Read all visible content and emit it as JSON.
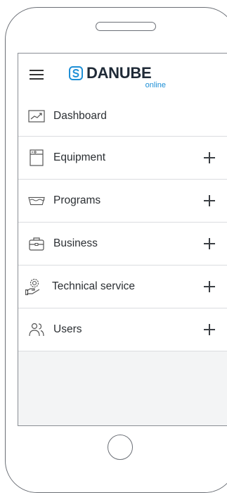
{
  "header": {
    "menu_icon": "hamburger-icon",
    "logo": {
      "icon": "danube-logo-icon",
      "name": "DANUBE",
      "sub": "online",
      "accent_color": "#1e8fd6"
    }
  },
  "menu": {
    "items": [
      {
        "label": "Dashboard",
        "icon": "chart-icon",
        "expandable": false
      },
      {
        "label": "Equipment",
        "icon": "washing-machine-icon",
        "expandable": true
      },
      {
        "label": "Programs",
        "icon": "basin-icon",
        "expandable": true
      },
      {
        "label": "Business",
        "icon": "briefcase-icon",
        "expandable": true
      },
      {
        "label": "Technical service",
        "icon": "technician-icon",
        "expandable": true
      },
      {
        "label": "Users",
        "icon": "users-icon",
        "expandable": true
      }
    ]
  }
}
